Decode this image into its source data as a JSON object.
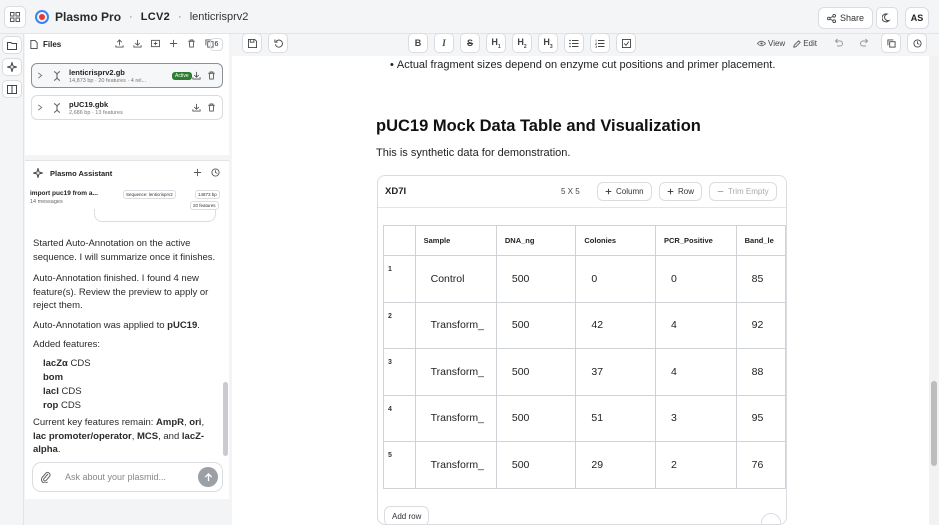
{
  "header": {
    "app_name": "Plasmo Pro",
    "separator": "·",
    "project": "LCV2",
    "file_name": "lenticrisprv2",
    "share_label": "Share",
    "avatar_initials": "AS"
  },
  "files_panel": {
    "title": "Files",
    "count": "6",
    "files": [
      {
        "name": "lenticrisprv2.gb",
        "meta": "14,873 bp · 20 features · 4 rel...",
        "badge": "Active"
      },
      {
        "name": "pUC19.gbk",
        "meta": "2,686 bp · 13 features"
      }
    ]
  },
  "assistant": {
    "title": "Plasmo Assistant",
    "conversation_title": "import puc19 from a...",
    "conversation_meta": "14 messages",
    "pill_sequence": "Sequence: lenticrisprv2",
    "pill_bp": "14873 bp",
    "pill_features": "20 features",
    "msg1": "Started Auto-Annotation on the active sequence. I will summarize once it finishes.",
    "msg2": "Auto-Annotation finished. I found 4 new feature(s). Review the preview to apply or reject them.",
    "msg3_pre": "Auto-Annotation was applied to ",
    "msg3_bold": "pUC19",
    "msg3_post": ".",
    "added_label": "Added features:",
    "features": [
      {
        "name": "lacZα",
        "type": "CDS"
      },
      {
        "name": "bom",
        "type": ""
      },
      {
        "name": "lacI",
        "type": "CDS"
      },
      {
        "name": "rop",
        "type": "CDS"
      }
    ],
    "remain_pre": "Current key features remain: ",
    "remain_1": "AmpR",
    "remain_sep1": ", ",
    "remain_2": "ori",
    "remain_sep2": ", ",
    "remain_3": "lac promoter/operator",
    "remain_sep3": ", ",
    "remain_4": "MCS",
    "remain_sep4": ", and ",
    "remain_5": "lacZ-alpha",
    "remain_end": ".",
    "input_placeholder": "Ask about your plasmid..."
  },
  "editor": {
    "view_label": "View",
    "edit_label": "Edit",
    "bullet_text": "Actual fragment sizes depend on enzyme cut positions and primer placement.",
    "doc_title": "pUC19 Mock Data Table and Visualization",
    "doc_subtitle": "This is synthetic data for demonstration.",
    "table": {
      "name": "XD7I",
      "dims": "5 X 5",
      "column_btn": "Column",
      "row_btn": "Row",
      "trim_btn": "Trim Empty",
      "add_row": "Add row",
      "headers": [
        "Sample",
        "DNA_ng",
        "Colonies",
        "PCR_Positive",
        "Band_le"
      ],
      "rows": [
        {
          "idx": "1",
          "cells": [
            "Control",
            "500",
            "0",
            "0",
            "85"
          ]
        },
        {
          "idx": "2",
          "cells": [
            "Transform_",
            "500",
            "42",
            "4",
            "92"
          ]
        },
        {
          "idx": "3",
          "cells": [
            "Transform_",
            "500",
            "37",
            "4",
            "88"
          ]
        },
        {
          "idx": "4",
          "cells": [
            "Transform_",
            "500",
            "51",
            "3",
            "95"
          ]
        },
        {
          "idx": "5",
          "cells": [
            "Transform_",
            "500",
            "29",
            "2",
            "76"
          ]
        }
      ]
    }
  }
}
